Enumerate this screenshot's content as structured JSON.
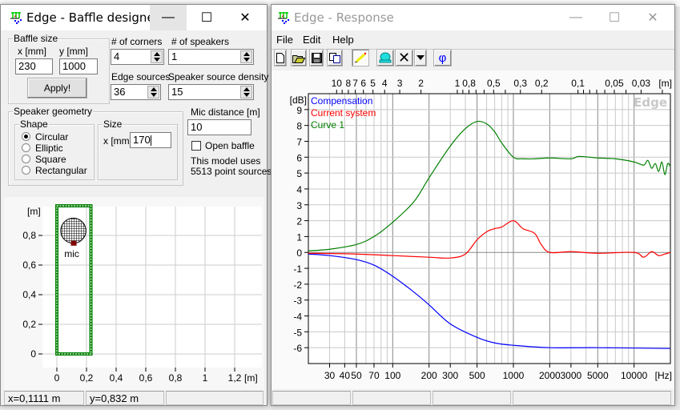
{
  "baffle_window": {
    "title": "Edge - Baffle designer",
    "baffle_size": {
      "label": "Baffle size",
      "x_label": "x [mm]",
      "y_label": "y [mm]",
      "x_value": "230",
      "y_value": "1000",
      "apply_label": "Apply!"
    },
    "corners": {
      "label": "# of corners",
      "value": "4"
    },
    "speakers": {
      "label": "# of speakers",
      "value": "1"
    },
    "edge_sources": {
      "label": "Edge sources",
      "value": "36"
    },
    "density": {
      "label": "Speaker source density",
      "value": "15"
    },
    "geometry": {
      "label": "Speaker geometry",
      "shape_label": "Shape",
      "shapes": [
        "Circular",
        "Elliptic",
        "Square",
        "Rectangular"
      ],
      "selected_shape": "Circular",
      "size_label": "Size",
      "size_x_label": "x [mm]",
      "size_x_value": "170"
    },
    "mic_distance": {
      "label": "Mic distance [m]",
      "value": "10"
    },
    "open_baffle": {
      "label": "Open baffle",
      "checked": false
    },
    "info_line1": "This model uses",
    "info_line2": "5513 point sources",
    "plot": {
      "x_ticks": [
        "0",
        "0,2",
        "0,4",
        "0,6",
        "0,8",
        "1",
        "1,2"
      ],
      "y_ticks": [
        "0",
        "0,2",
        "0,4",
        "0,6",
        "0,8"
      ],
      "x_unit": "[m]",
      "y_unit": "[m]",
      "xlim": [
        -0.1,
        1.38
      ],
      "ylim": [
        -0.09,
        1.0
      ],
      "baffle_m": [
        0.23,
        1.0
      ],
      "speaker_center_m": [
        0.1111,
        0.832
      ],
      "speaker_diameter_m": 0.17,
      "mic_label": "mic",
      "baffle_color": "#008000",
      "mic_color": "#800000"
    },
    "status": {
      "x": "x=0,1111 m",
      "y": "y=0,832 m",
      "extra": ""
    }
  },
  "response_window": {
    "title": "Edge - Response",
    "menu": [
      "File",
      "Edit",
      "Help"
    ],
    "toolbar": [
      "new-icon",
      "open-icon",
      "save-icon",
      "copy-icon",
      "pen-icon",
      "globe-icon",
      "delete-icon",
      "dropdown-icon",
      "phase-icon"
    ],
    "phase_glyph": "φ",
    "watermark": "Edge",
    "status": [
      "",
      "",
      "",
      ""
    ]
  },
  "chart_data": {
    "type": "line",
    "x_scale": "log",
    "xlim": [
      20,
      20000
    ],
    "ylim": [
      -7,
      10
    ],
    "xlabel": "[Hz]",
    "ylabel": "[dB]",
    "x_ticks": [
      30,
      40,
      50,
      70,
      100,
      200,
      300,
      500,
      1000,
      2000,
      3000,
      5000,
      10000
    ],
    "y_ticks": [
      -6,
      -5,
      -4,
      -3,
      -2,
      -1,
      0,
      1,
      2,
      3,
      4,
      5,
      6,
      7,
      8,
      9
    ],
    "top_axis": {
      "unit": "[m]",
      "labels": [
        "10",
        "8",
        "7",
        "6",
        "5",
        "4",
        "3",
        "2",
        "1",
        "0,8",
        "0,5",
        "0,3",
        "0,2",
        "0,1",
        "0,05",
        "0,03"
      ],
      "values": [
        10,
        8,
        7,
        6,
        5,
        4,
        3,
        2,
        1,
        0.8,
        0.5,
        0.3,
        0.2,
        0.1,
        0.05,
        0.03
      ]
    },
    "grid": true,
    "legend_position": "top-left",
    "series": [
      {
        "name": "Compensation",
        "color": "#0000ff",
        "x": [
          20,
          30,
          50,
          70,
          100,
          150,
          200,
          300,
          500,
          700,
          1000,
          2000,
          5000,
          20000
        ],
        "y": [
          -0.1,
          -0.2,
          -0.45,
          -0.8,
          -1.5,
          -2.5,
          -3.3,
          -4.5,
          -5.35,
          -5.7,
          -5.85,
          -6.0,
          -6.0,
          -6.05
        ]
      },
      {
        "name": "Current system",
        "color": "#ff0000",
        "x": [
          20,
          50,
          100,
          200,
          300,
          400,
          500,
          600,
          700,
          800,
          1000,
          1200,
          1500,
          1700,
          2000,
          3000,
          5000,
          10000,
          12000,
          14000,
          16000,
          18000,
          20000
        ],
        "y": [
          -0.05,
          -0.1,
          -0.2,
          -0.3,
          -0.35,
          -0.1,
          0.8,
          1.3,
          1.5,
          1.6,
          2.0,
          1.5,
          1.2,
          0.5,
          0.0,
          0.05,
          -0.05,
          0.0,
          -0.3,
          0.05,
          -0.2,
          -0.1,
          0.0
        ]
      },
      {
        "name": "Curve 1",
        "color": "#008000",
        "x": [
          20,
          30,
          50,
          70,
          100,
          150,
          200,
          300,
          400,
          500,
          600,
          700,
          800,
          1000,
          1200,
          1500,
          2000,
          3000,
          3500,
          5000,
          7000,
          10000,
          12000,
          13000,
          14000,
          15000,
          16000,
          17000,
          18000,
          19000,
          20000
        ],
        "y": [
          0.1,
          0.2,
          0.5,
          1.0,
          1.9,
          3.2,
          4.7,
          6.7,
          7.8,
          8.25,
          8.1,
          7.6,
          6.9,
          6.0,
          5.9,
          5.9,
          5.95,
          5.9,
          6.05,
          5.95,
          5.9,
          5.7,
          5.5,
          5.8,
          5.3,
          5.6,
          5.1,
          5.7,
          4.9,
          5.6,
          5.4
        ]
      }
    ]
  }
}
